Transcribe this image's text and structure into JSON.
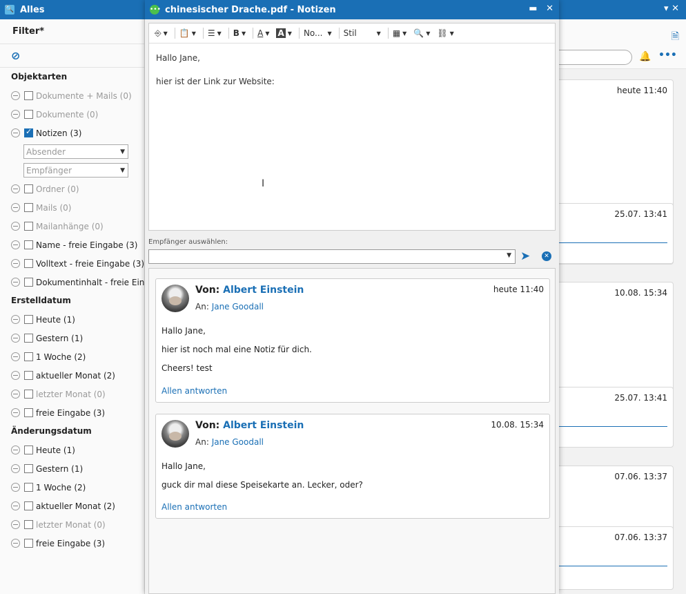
{
  "main_window": {
    "title": "Alles",
    "controls": "▾  ✕"
  },
  "filter": {
    "title": "Filter*",
    "clear_icon": "ban-icon",
    "sections": {
      "objektarten": "Objektarten",
      "erstelldatum": "Erstelldatum",
      "aenderungsdatum": "Änderungsdatum"
    },
    "objektarten": [
      {
        "label": "Dokumente + Mails (0)",
        "checked": false,
        "muted": true
      },
      {
        "label": "Dokumente (0)",
        "checked": false,
        "muted": true
      },
      {
        "label": "Notizen (3)",
        "checked": true,
        "muted": false
      }
    ],
    "absender_placeholder": "Absender",
    "empfaenger_placeholder": "Empfänger",
    "objektarten_more": [
      {
        "label": "Ordner (0)",
        "checked": false,
        "muted": true
      },
      {
        "label": "Mails (0)",
        "checked": false,
        "muted": true
      },
      {
        "label": "Mailanhänge (0)",
        "checked": false,
        "muted": true
      },
      {
        "label": "Name - freie Eingabe (3)",
        "checked": false,
        "muted": false
      },
      {
        "label": "Volltext - freie Eingabe (3)",
        "checked": false,
        "muted": false
      },
      {
        "label": "Dokumentinhalt - freie Eingabe",
        "checked": false,
        "muted": false
      }
    ],
    "erstelldatum": [
      {
        "label": "Heute (1)",
        "muted": false
      },
      {
        "label": "Gestern (1)",
        "muted": false
      },
      {
        "label": "1 Woche (2)",
        "muted": false
      },
      {
        "label": "aktueller Monat (2)",
        "muted": false
      },
      {
        "label": "letzter Monat (0)",
        "muted": true
      },
      {
        "label": "freie Eingabe (3)",
        "muted": false
      }
    ],
    "aenderungsdatum": [
      {
        "label": "Heute (1)",
        "muted": false
      },
      {
        "label": "Gestern (1)",
        "muted": false
      },
      {
        "label": "1 Woche (2)",
        "muted": false
      },
      {
        "label": "aktueller Monat (2)",
        "muted": false
      },
      {
        "label": "letzter Monat (0)",
        "muted": true
      },
      {
        "label": "freie Eingabe (3)",
        "muted": false
      }
    ]
  },
  "background_cards": [
    {
      "time": "heute 11:40"
    },
    {
      "time": "25.07. 13:41"
    },
    {
      "time": "10.08. 15:34"
    },
    {
      "time": "25.07. 13:41"
    },
    {
      "time": "07.06. 13:37"
    },
    {
      "time": "07.06. 13:37"
    }
  ],
  "notes_window": {
    "title": "chinesischer Drache.pdf - Notizen",
    "minimize": "▬",
    "close": "✕",
    "toolbar": {
      "format_label": "No...",
      "style_label": "Stil"
    },
    "editor_lines": [
      "Hallo Jane,",
      "hier ist der Link zur Website:"
    ],
    "recipient_label": "Empfänger auswählen:",
    "notes": [
      {
        "from_prefix": "Von:",
        "from_name": "Albert Einstein",
        "to_prefix": "An:",
        "to_name": "Jane Goodall",
        "time": "heute 11:40",
        "body": [
          "Hallo Jane,",
          "hier ist noch mal eine Notiz für dich.",
          "Cheers! test"
        ],
        "reply": "Allen antworten"
      },
      {
        "from_prefix": "Von:",
        "from_name": "Albert Einstein",
        "to_prefix": "An:",
        "to_name": "Jane Goodall",
        "time": "10.08. 15:34",
        "body": [
          "Hallo Jane,",
          "guck dir mal diese Speisekarte an. Lecker, oder?"
        ],
        "reply": "Allen antworten"
      }
    ]
  }
}
